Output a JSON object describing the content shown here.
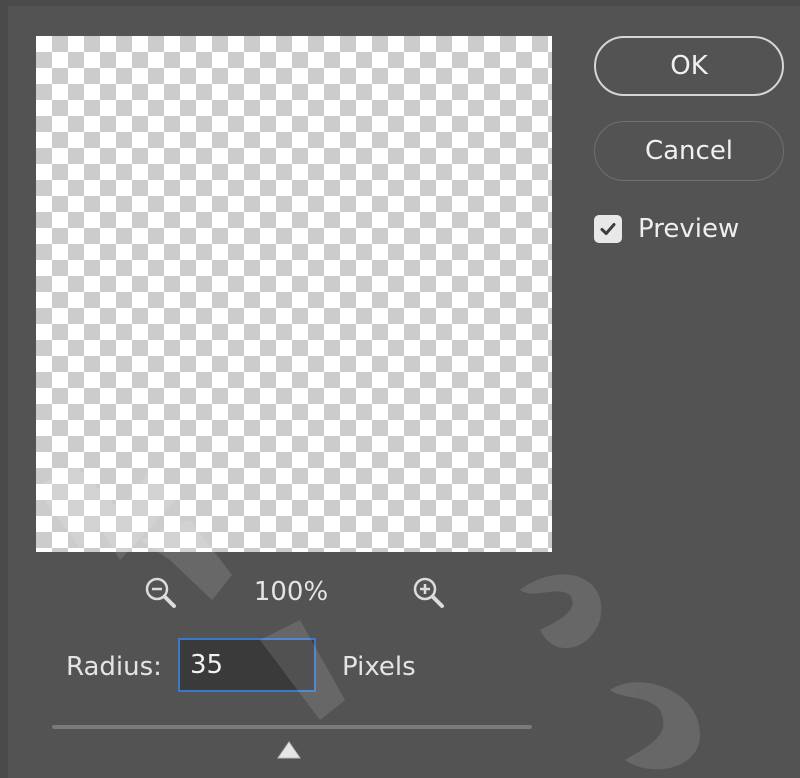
{
  "buttons": {
    "ok_label": "OK",
    "cancel_label": "Cancel"
  },
  "preview_option": {
    "label": "Preview",
    "checked": true
  },
  "zoom": {
    "level": "100%",
    "zoom_out_icon": "zoom-out-magnifier-icon",
    "zoom_in_icon": "zoom-in-magnifier-icon"
  },
  "radius": {
    "label": "Radius:",
    "value": "35",
    "units": "Pixels",
    "slider_icon": "triangle-thumb-icon"
  },
  "colors": {
    "background": "#535353",
    "input_border_focus": "#3b78c9",
    "checkerboard_dark": "#cccccc",
    "checkerboard_light": "#ffffff"
  }
}
